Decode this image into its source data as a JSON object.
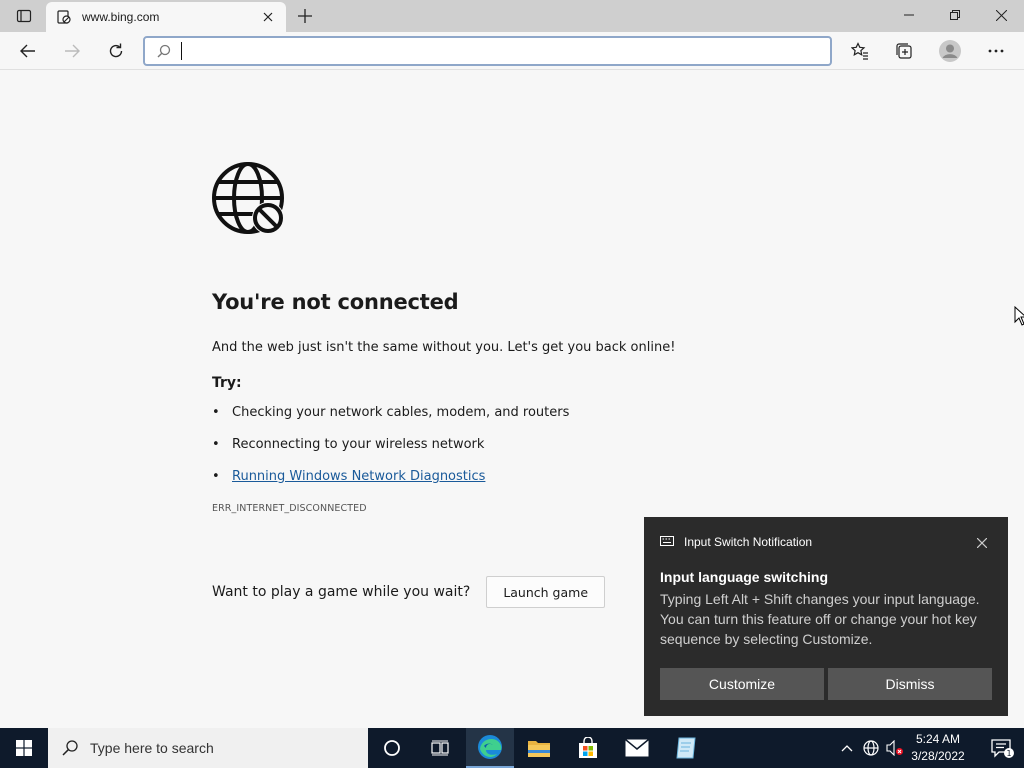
{
  "browser": {
    "tab_title": "www.bing.com",
    "address_value": "",
    "address_placeholder": ""
  },
  "error": {
    "heading": "You're not connected",
    "subtext": "And the web just isn't the same without you. Let's get you back online!",
    "try_label": "Try:",
    "suggestions": [
      "Checking your network cables, modem, and routers",
      "Reconnecting to your wireless network",
      "Running Windows Network Diagnostics"
    ],
    "error_code": "ERR_INTERNET_DISCONNECTED",
    "game_prompt": "Want to play a game while you wait?",
    "game_button": "Launch game"
  },
  "toast": {
    "app": "Input Switch Notification",
    "title": "Input language switching",
    "body": "Typing Left Alt + Shift changes your input language. You can turn this feature off or change your hot key sequence by selecting Customize.",
    "customize": "Customize",
    "dismiss": "Dismiss"
  },
  "taskbar": {
    "search_placeholder": "Type here to search",
    "time": "5:24 AM",
    "date": "3/28/2022",
    "notification_count": "1"
  },
  "colors": {
    "link": "#1a5a9a",
    "toast_bg": "#2b2b2b",
    "taskbar_bg": "#0e1a2b"
  }
}
